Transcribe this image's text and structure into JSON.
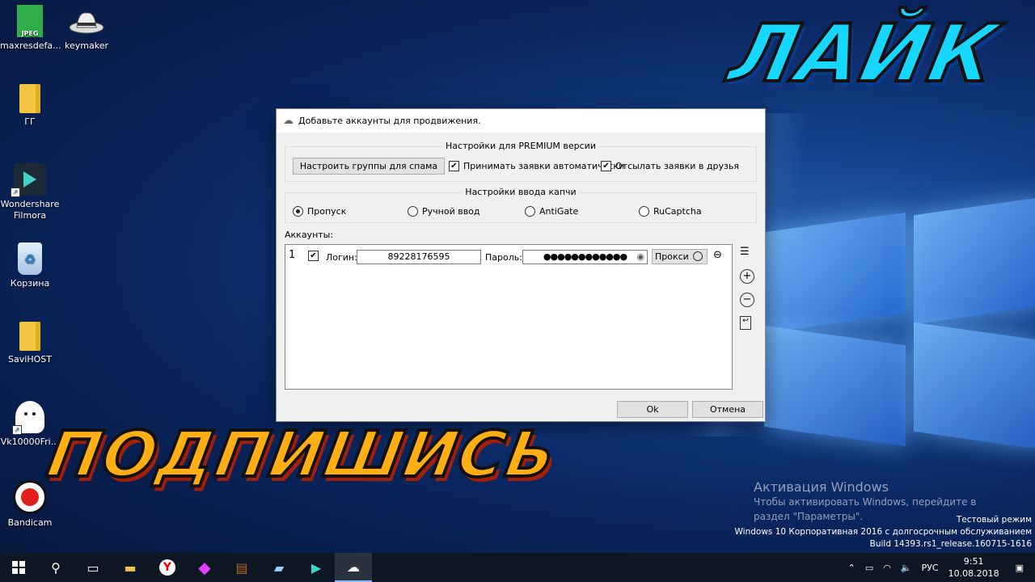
{
  "desktop": {
    "icons": [
      {
        "label": "maxresdefa...",
        "icon": "jpeg-file-icon",
        "badge": "JPEG"
      },
      {
        "label": "keymaker",
        "icon": "hat-icon"
      },
      {
        "label": "ГГ",
        "icon": "folder-icon"
      },
      {
        "label": "Wondershare Filmora",
        "icon": "filmora-icon"
      },
      {
        "label": "Корзина",
        "icon": "recycle-bin-icon"
      },
      {
        "label": "SaviHOST",
        "icon": "folder-icon"
      },
      {
        "label": "Vk10000Fri...",
        "icon": "ghost-cat-icon"
      },
      {
        "label": "Bandicam",
        "icon": "bandicam-record-icon"
      }
    ]
  },
  "overlay": {
    "like_text": "ЛАЙК",
    "subscribe_text": "ПОДПИШИСЬ"
  },
  "dialog": {
    "title": "Добавьте аккаунты для продвижения.",
    "premium_group": {
      "title": "Настройки для PREMIUM версии",
      "configure_groups_button": "Настроить группы для спама",
      "accept_requests_label": "Принимать заявки автоматически",
      "accept_requests_checked": true,
      "send_requests_label": "Отсылать заявки в друзья",
      "send_requests_checked": true
    },
    "captcha_group": {
      "title": "Настройки ввода капчи",
      "options": [
        "Пропуск",
        "Ручной ввод",
        "AntiGate",
        "RuCaptcha"
      ],
      "selected": "Пропуск"
    },
    "accounts": {
      "label": "Аккаунты:",
      "rows": [
        {
          "index": "1",
          "checked": true,
          "login_label": "Логин:",
          "login_value": "89228176595",
          "password_label": "Пароль:",
          "password_value": "●●●●●●●●●●●●",
          "proxy_label": "Прокси"
        }
      ]
    },
    "ok_button": "Ok",
    "cancel_button": "Отмена"
  },
  "watermark": {
    "line1": "Активация Windows",
    "line2": "Чтобы активировать Windows, перейдите в",
    "line3": "раздел \"Параметры\"."
  },
  "build_info": {
    "line1": "Тестовый режим",
    "line2": "Windows 10 Корпоративная 2016 с долгосрочным обслуживанием",
    "line3": "Build 14393.rs1_release.160715-1616"
  },
  "taskbar": {
    "language": "РУС",
    "time": "9:51",
    "date": "10.08.2018"
  }
}
